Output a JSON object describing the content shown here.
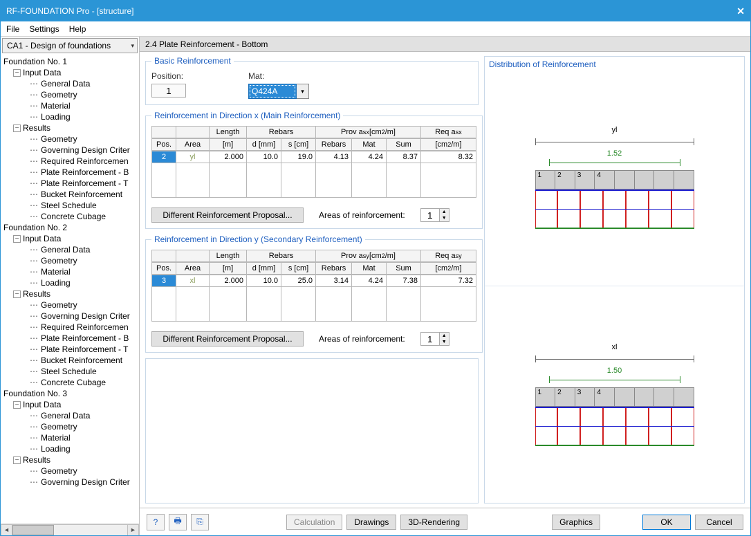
{
  "window": {
    "title": "RF-FOUNDATION Pro - [structure]"
  },
  "menubar": [
    "File",
    "Settings",
    "Help"
  ],
  "combo": {
    "label": "CA1 - Design of foundations"
  },
  "tree": [
    {
      "lv": 0,
      "label": "Foundation No. 1",
      "exp": false
    },
    {
      "lv": 1,
      "label": "Input Data",
      "exp": "-"
    },
    {
      "lv": 2,
      "label": "General Data"
    },
    {
      "lv": 2,
      "label": "Geometry"
    },
    {
      "lv": 2,
      "label": "Material"
    },
    {
      "lv": 2,
      "label": "Loading"
    },
    {
      "lv": 1,
      "label": "Results",
      "exp": "-"
    },
    {
      "lv": 2,
      "label": "Geometry"
    },
    {
      "lv": 2,
      "label": "Governing Design Criter"
    },
    {
      "lv": 2,
      "label": "Required Reinforcemen"
    },
    {
      "lv": 2,
      "label": "Plate Reinforcement - B"
    },
    {
      "lv": 2,
      "label": "Plate Reinforcement - T"
    },
    {
      "lv": 2,
      "label": "Bucket Reinforcement"
    },
    {
      "lv": 2,
      "label": "Steel Schedule"
    },
    {
      "lv": 2,
      "label": "Concrete Cubage"
    },
    {
      "lv": 0,
      "label": "Foundation No. 2",
      "exp": false
    },
    {
      "lv": 1,
      "label": "Input Data",
      "exp": "-"
    },
    {
      "lv": 2,
      "label": "General Data"
    },
    {
      "lv": 2,
      "label": "Geometry"
    },
    {
      "lv": 2,
      "label": "Material"
    },
    {
      "lv": 2,
      "label": "Loading"
    },
    {
      "lv": 1,
      "label": "Results",
      "exp": "-"
    },
    {
      "lv": 2,
      "label": "Geometry"
    },
    {
      "lv": 2,
      "label": "Governing Design Criter"
    },
    {
      "lv": 2,
      "label": "Required Reinforcemen"
    },
    {
      "lv": 2,
      "label": "Plate Reinforcement - B"
    },
    {
      "lv": 2,
      "label": "Plate Reinforcement - T"
    },
    {
      "lv": 2,
      "label": "Bucket Reinforcement"
    },
    {
      "lv": 2,
      "label": "Steel Schedule"
    },
    {
      "lv": 2,
      "label": "Concrete Cubage"
    },
    {
      "lv": 0,
      "label": "Foundation No. 3",
      "exp": false
    },
    {
      "lv": 1,
      "label": "Input Data",
      "exp": "-"
    },
    {
      "lv": 2,
      "label": "General Data"
    },
    {
      "lv": 2,
      "label": "Geometry"
    },
    {
      "lv": 2,
      "label": "Material"
    },
    {
      "lv": 2,
      "label": "Loading"
    },
    {
      "lv": 1,
      "label": "Results",
      "exp": "-"
    },
    {
      "lv": 2,
      "label": "Geometry"
    },
    {
      "lv": 2,
      "label": "Governing Design Criter"
    }
  ],
  "header": "2.4 Plate Reinforcement - Bottom",
  "basic": {
    "legend": "Basic Reinforcement",
    "pos_label": "Position:",
    "pos_val": "1",
    "mat_label": "Mat:",
    "mat_val": "Q424A"
  },
  "rx": {
    "legend": "Reinforcement in Direction x (Main Reinforcement)",
    "h1": [
      "",
      "",
      "Length",
      "Rebars",
      "Prov a sx [cm²/m]",
      "Req a sx"
    ],
    "h2": [
      "Pos.",
      "Area",
      "[m]",
      "d [mm]",
      "s [cm]",
      "Rebars",
      "Mat",
      "Sum",
      "[cm²/m]"
    ],
    "row": [
      "2",
      "yl",
      "2.000",
      "10.0",
      "19.0",
      "4.13",
      "4.24",
      "8.37",
      "8.32"
    ],
    "btn": "Different Reinforcement Proposal...",
    "areas_label": "Areas of reinforcement:",
    "areas_val": "1"
  },
  "ry": {
    "legend": "Reinforcement in Direction y (Secondary Reinforcement)",
    "h1": [
      "",
      "",
      "Length",
      "Rebars",
      "Prov a sy [cm²/m]",
      "Req a sy"
    ],
    "h2": [
      "Pos.",
      "Area",
      "[m]",
      "d [mm]",
      "s [cm]",
      "Rebars",
      "Mat",
      "Sum",
      "[cm²/m]"
    ],
    "row": [
      "3",
      "xl",
      "2.000",
      "10.0",
      "25.0",
      "3.14",
      "4.24",
      "7.38",
      "7.32"
    ],
    "btn": "Different Reinforcement Proposal...",
    "areas_label": "Areas of reinforcement:",
    "areas_val": "1"
  },
  "dist": {
    "legend": "Distribution of Reinforcement",
    "top": {
      "axis": "yl",
      "dim": "1.52",
      "nums": [
        "1",
        "2",
        "3",
        "4"
      ]
    },
    "bot": {
      "axis": "xl",
      "dim": "1.50",
      "nums": [
        "1",
        "2",
        "3",
        "4"
      ]
    }
  },
  "bottombar": {
    "calc": "Calculation",
    "draw": "Drawings",
    "render": "3D-Rendering",
    "graphics": "Graphics",
    "ok": "OK",
    "cancel": "Cancel"
  }
}
